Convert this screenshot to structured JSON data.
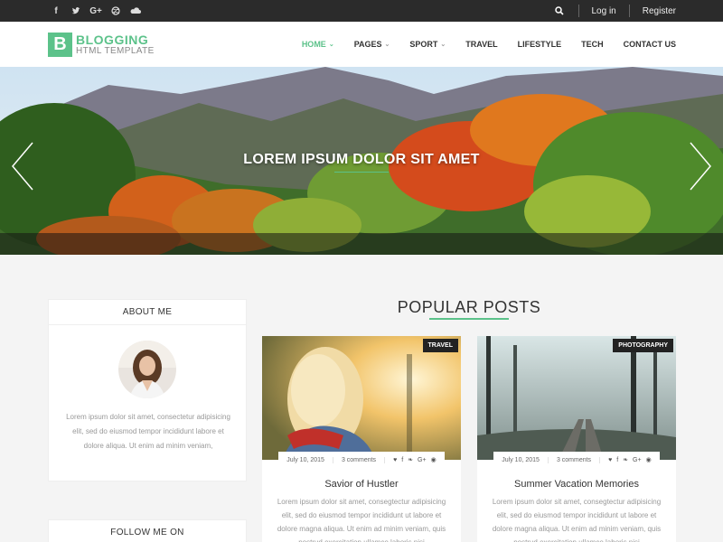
{
  "topbar": {
    "social": [
      "f",
      "t",
      "G+",
      "d",
      "s"
    ],
    "login": "Log in",
    "register": "Register"
  },
  "header": {
    "logo_letter": "B",
    "logo_title": "BLOGGING",
    "logo_subtitle": "HTML TEMPLATE",
    "nav": [
      {
        "label": "HOME",
        "dropdown": true,
        "active": true
      },
      {
        "label": "PAGES",
        "dropdown": true
      },
      {
        "label": "SPORT",
        "dropdown": true
      },
      {
        "label": "TRAVEL"
      },
      {
        "label": "LIFESTYLE"
      },
      {
        "label": "TECH"
      },
      {
        "label": "CONTACT US"
      }
    ]
  },
  "hero": {
    "title": "LOREM IPSUM DOLOR SIT AMET"
  },
  "sidebar": {
    "about_title": "ABOUT ME",
    "about_text": "Lorem ipsum dolor sit amet, consectetur adipisicing elit, sed do eiusmod tempor incididunt labore et dolore aliqua. Ut enim ad minim veniam,",
    "follow_title": "FOLLOW ME ON"
  },
  "popular": {
    "title": "POPULAR POSTS",
    "posts": [
      {
        "tag": "TRAVEL",
        "date": "July 10, 2015",
        "comments": "3 comments",
        "title": "Savior of Hustler",
        "excerpt": "Lorem ipsum dolor sit amet, consegtectur adipisicing elit, sed do eiusmod tempor incididunt ut labore et dolore magna aliqua. Ut enim ad minim veniam, quis nostrud exercitation ullamco laboris nisi"
      },
      {
        "tag": "PHOTOGRAPHY",
        "date": "July 10, 2015",
        "comments": "3 comments",
        "title": "Summer Vacation Memories",
        "excerpt": "Lorem ipsum dolor sit amet, consegtectur adipisicing elit, sed do eiusmod tempor incididunt ut labore et dolore magna aliqua. Ut enim ad minim veniam, quis nostrud exercitation ullamco laboris nisi"
      }
    ]
  },
  "colors": {
    "accent": "#5cc28a",
    "topbar": "#2b2b2b"
  }
}
